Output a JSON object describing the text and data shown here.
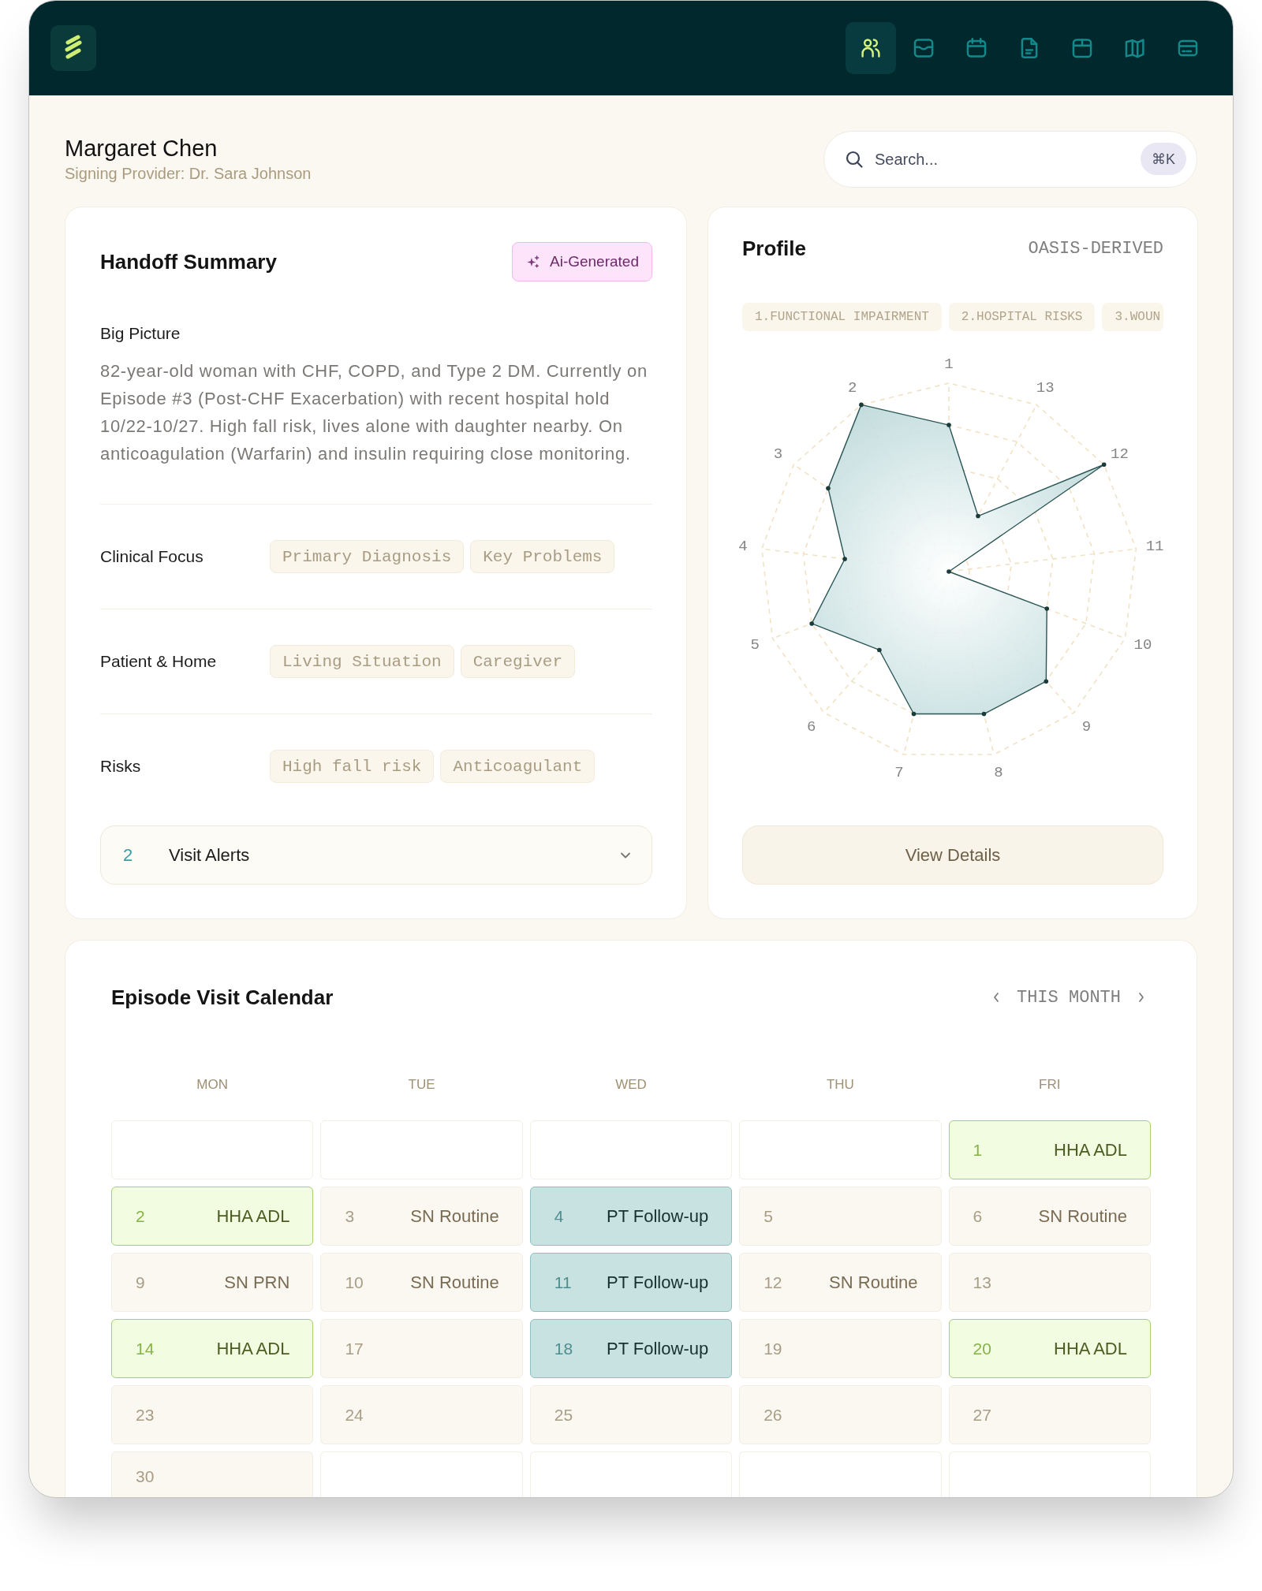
{
  "nav": {
    "items": [
      {
        "selected": true
      },
      {
        "selected": false
      },
      {
        "selected": false
      },
      {
        "selected": false
      },
      {
        "selected": false
      },
      {
        "selected": false
      },
      {
        "selected": false
      }
    ]
  },
  "header": {
    "name": "Margaret Chen",
    "subtitle": "Signing Provider: Dr. Sara Johnson"
  },
  "search": {
    "placeholder": "Search...",
    "shortcut": "⌘K"
  },
  "handoff": {
    "title": "Handoff Summary",
    "badge": "Ai-Generated",
    "big_picture": {
      "label": "Big Picture",
      "text": "82-year-old woman with CHF, COPD, and Type 2 DM. Currently on Episode #3 (Post-CHF Exacerbation) with recent hospital hold 10/22-10/27. High fall risk, lives alone with daughter nearby. On anticoagulation (Warfarin) and insulin requiring close monitoring."
    },
    "sections": [
      {
        "label": "Clinical Focus",
        "tags": [
          "Primary Diagnosis",
          "Key Problems"
        ]
      },
      {
        "label": "Patient & Home",
        "tags": [
          "Living Situation",
          "Caregiver"
        ]
      },
      {
        "label": "Risks",
        "tags": [
          "High fall risk",
          "Anticoagulant"
        ]
      }
    ],
    "alerts": {
      "count": "2",
      "label": "Visit Alerts",
      "expanded": false
    }
  },
  "profile": {
    "title": "Profile",
    "source": "OASIS-DERIVED",
    "categories": [
      "1.FUNCTIONAL IMPAIRMENT",
      "2.HOSPITAL RISKS",
      "3.WOUN"
    ],
    "axes": [
      "1",
      "2",
      "3",
      "4",
      "5",
      "6",
      "7",
      "8",
      "9",
      "10",
      "11",
      "12",
      "13"
    ],
    "button": "View Details"
  },
  "calendar": {
    "title": "Episode Visit Calendar",
    "period": "THIS MONTH",
    "weekdays": [
      "MON",
      "TUE",
      "WED",
      "THU",
      "FRI"
    ],
    "weeks": [
      [
        {
          "kind": "blank"
        },
        {
          "kind": "blank"
        },
        {
          "kind": "blank"
        },
        {
          "kind": "blank"
        },
        {
          "kind": "hha",
          "date": "1",
          "visit": "HHA ADL"
        }
      ],
      [
        {
          "kind": "hha",
          "date": "2",
          "visit": "HHA ADL"
        },
        {
          "kind": "day",
          "date": "3",
          "visit": "SN Routine"
        },
        {
          "kind": "pt",
          "date": "4",
          "visit": "PT Follow-up"
        },
        {
          "kind": "day",
          "date": "5"
        },
        {
          "kind": "day",
          "date": "6",
          "visit": "SN Routine"
        }
      ],
      [
        {
          "kind": "day",
          "date": "9",
          "visit": "SN PRN"
        },
        {
          "kind": "day",
          "date": "10",
          "visit": "SN Routine"
        },
        {
          "kind": "pt",
          "date": "11",
          "visit": "PT Follow-up"
        },
        {
          "kind": "day",
          "date": "12",
          "visit": "SN Routine"
        },
        {
          "kind": "day",
          "date": "13"
        }
      ],
      [
        {
          "kind": "hha",
          "date": "14",
          "visit": "HHA ADL"
        },
        {
          "kind": "day",
          "date": "17"
        },
        {
          "kind": "pt",
          "date": "18",
          "visit": "PT Follow-up"
        },
        {
          "kind": "day",
          "date": "19"
        },
        {
          "kind": "hha",
          "date": "20",
          "visit": "HHA ADL"
        }
      ],
      [
        {
          "kind": "day",
          "date": "23"
        },
        {
          "kind": "day",
          "date": "24"
        },
        {
          "kind": "day",
          "date": "25"
        },
        {
          "kind": "day",
          "date": "26"
        },
        {
          "kind": "day",
          "date": "27"
        }
      ],
      [
        {
          "kind": "day",
          "date": "30"
        },
        {
          "kind": "blank"
        },
        {
          "kind": "blank"
        },
        {
          "kind": "blank"
        },
        {
          "kind": "blank"
        }
      ]
    ]
  }
}
